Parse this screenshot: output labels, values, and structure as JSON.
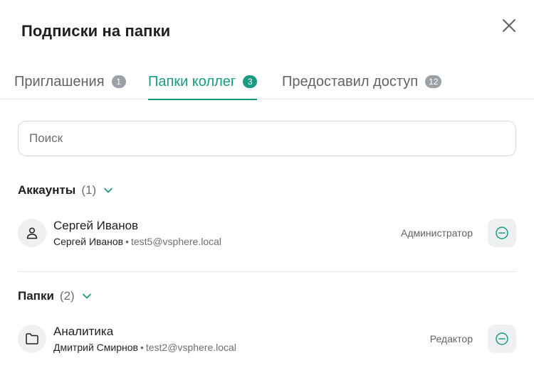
{
  "dialog": {
    "title": "Подписки на папки",
    "close_icon": "close-icon"
  },
  "tabs": [
    {
      "label": "Приглашения",
      "count": "1",
      "active": false
    },
    {
      "label": "Папки коллег",
      "count": "3",
      "active": true
    },
    {
      "label": "Предоставил доступ",
      "count": "12",
      "active": false
    }
  ],
  "search": {
    "placeholder": "Поиск",
    "value": ""
  },
  "sections": {
    "accounts": {
      "title": "Аккаунты",
      "count": "(1)",
      "items": [
        {
          "icon": "user-icon",
          "name": "Сергей Иванов",
          "owner": "Сергей Иванов",
          "separator": "•",
          "email": "test5@vsphere.local",
          "role": "Администратор",
          "action_icon": "remove-circle-icon"
        }
      ]
    },
    "folders": {
      "title": "Папки",
      "count": "(2)",
      "items": [
        {
          "icon": "folder-icon",
          "name": "Аналитика",
          "owner": "Дмитрий Смирнов",
          "separator": "•",
          "email": "test2@vsphere.local",
          "role": "Редактор",
          "action_icon": "remove-circle-icon"
        }
      ]
    }
  },
  "colors": {
    "accent": "#1a9a7e",
    "badge_inactive": "#9aa0a6",
    "muted_text": "#6b6f74",
    "icon_bg": "#eef0f2"
  }
}
